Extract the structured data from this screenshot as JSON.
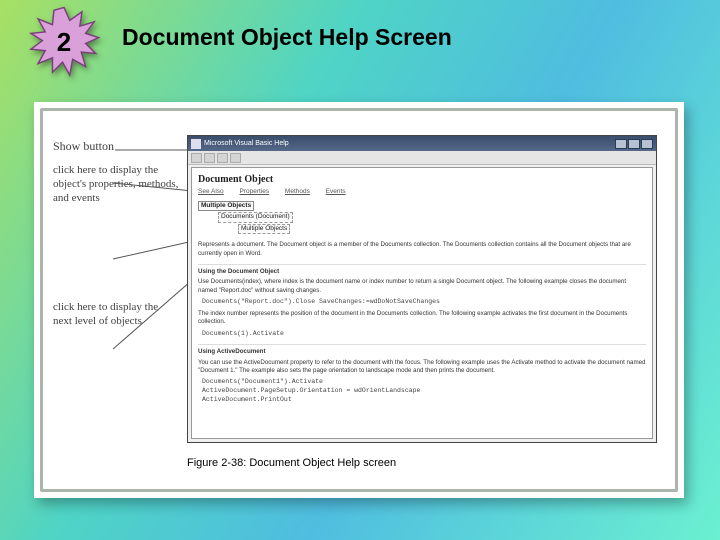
{
  "slide": {
    "number": "2",
    "title": "Document Object Help Screen"
  },
  "annotations": {
    "show_button": "Show button",
    "callout_props": "click here to display the object's properties, methods, and events",
    "callout_next": "click here to display the next level of objects"
  },
  "window": {
    "title": "Microsoft Visual Basic Help",
    "btn_min": "_",
    "btn_max": "□",
    "btn_close": "×"
  },
  "help": {
    "doc_title": "Document Object",
    "links": {
      "see_also": "See Also",
      "properties": "Properties",
      "methods": "Methods",
      "events": "Events"
    },
    "tree": {
      "l1": "Multiple Objects",
      "l2": "Documents (Document)",
      "l3": "Multiple Objects"
    },
    "para_intro": "Represents a document. The Document object is a member of the Documents collection. The Documents collection contains all the Document objects that are currently open in Word.",
    "sec_using_title": "Using the Document Object",
    "para_using": "Use Documents(index), where index is the document name or index number to return a single Document object. The following example closes the document named \"Report.doc\" without saving changes.",
    "code_close": "Documents(\"Report.doc\").Close SaveChanges:=wdDoNotSaveChanges",
    "para_index": "The index number represents the position of the document in the Documents collection. The following example activates the first document in the Documents collection.",
    "code_activate": "Documents(1).Activate",
    "sec_active_title": "Using ActiveDocument",
    "para_active": "You can use the ActiveDocument property to refer to the document with the focus. The following example uses the Activate method to activate the document named \"Document 1.\" The example also sets the page orientation to landscape mode and then prints the document.",
    "code_active": "Documents(\"Document1\").Activate\nActiveDocument.PageSetup.Orientation = wdOrientLandscape\nActiveDocument.PrintOut"
  },
  "caption": "Figure 2-38:  Document Object Help screen"
}
